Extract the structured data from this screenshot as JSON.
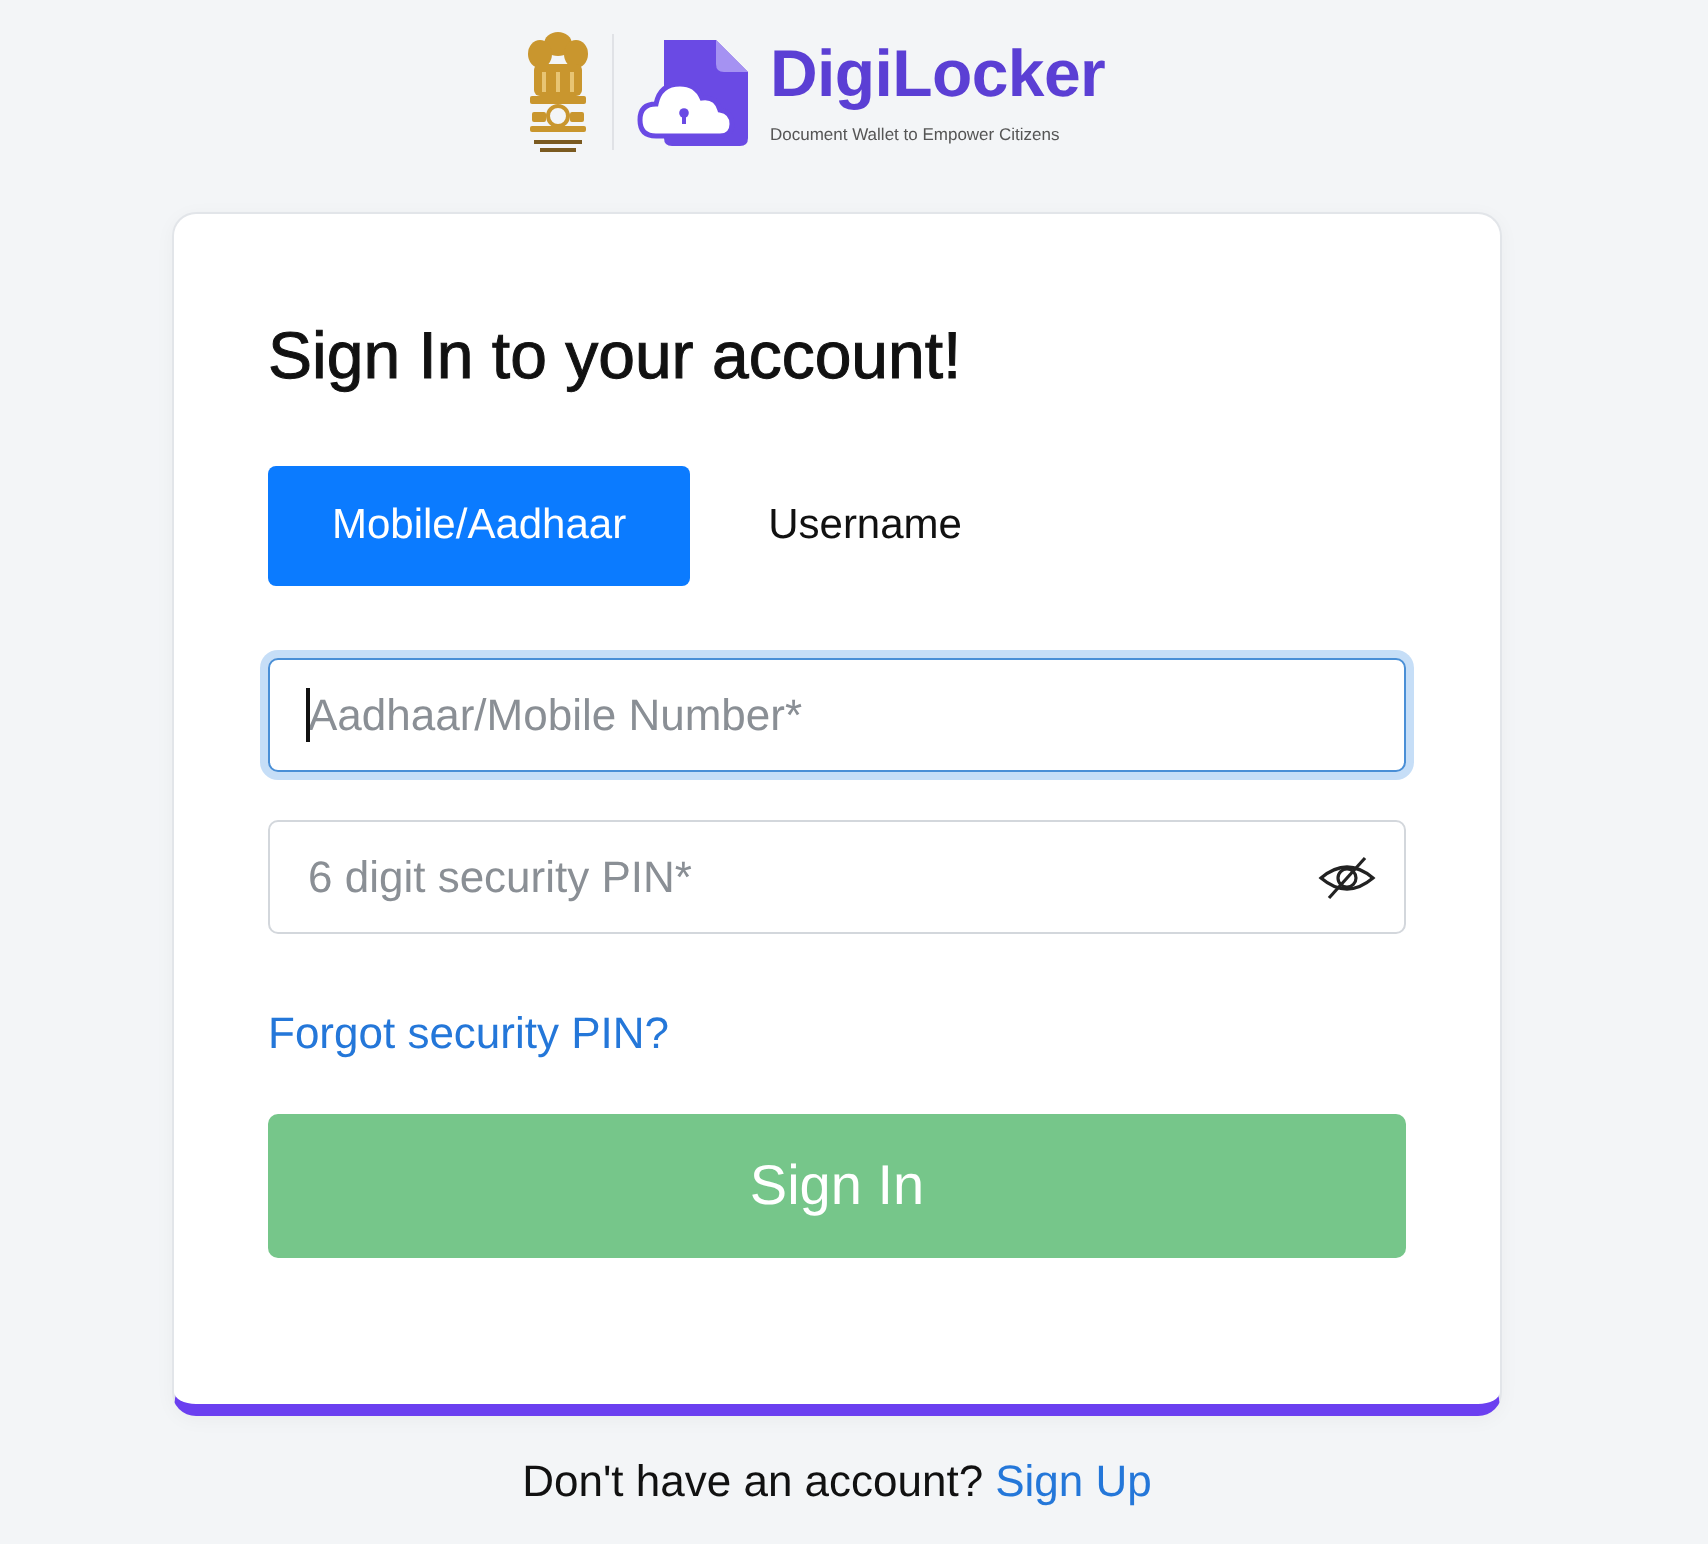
{
  "header": {
    "brand": "DigiLocker",
    "tagline": "Document Wallet to Empower Citizens"
  },
  "card": {
    "title": "Sign In to your account!",
    "tabs": [
      {
        "label": "Mobile/Aadhaar",
        "selected": true
      },
      {
        "label": "Username",
        "selected": false
      }
    ],
    "fields": [
      {
        "kind": "text",
        "placeholder": "Aadhaar/Mobile Number*",
        "focused": true
      },
      {
        "kind": "password",
        "placeholder": "6 digit security PIN*",
        "focused": false
      }
    ],
    "forgot_link": "Forgot security PIN?",
    "submit": {
      "label": "Sign In",
      "disabled": true
    }
  },
  "footer": {
    "text": "Don't have an account?",
    "link": "Sign Up"
  }
}
